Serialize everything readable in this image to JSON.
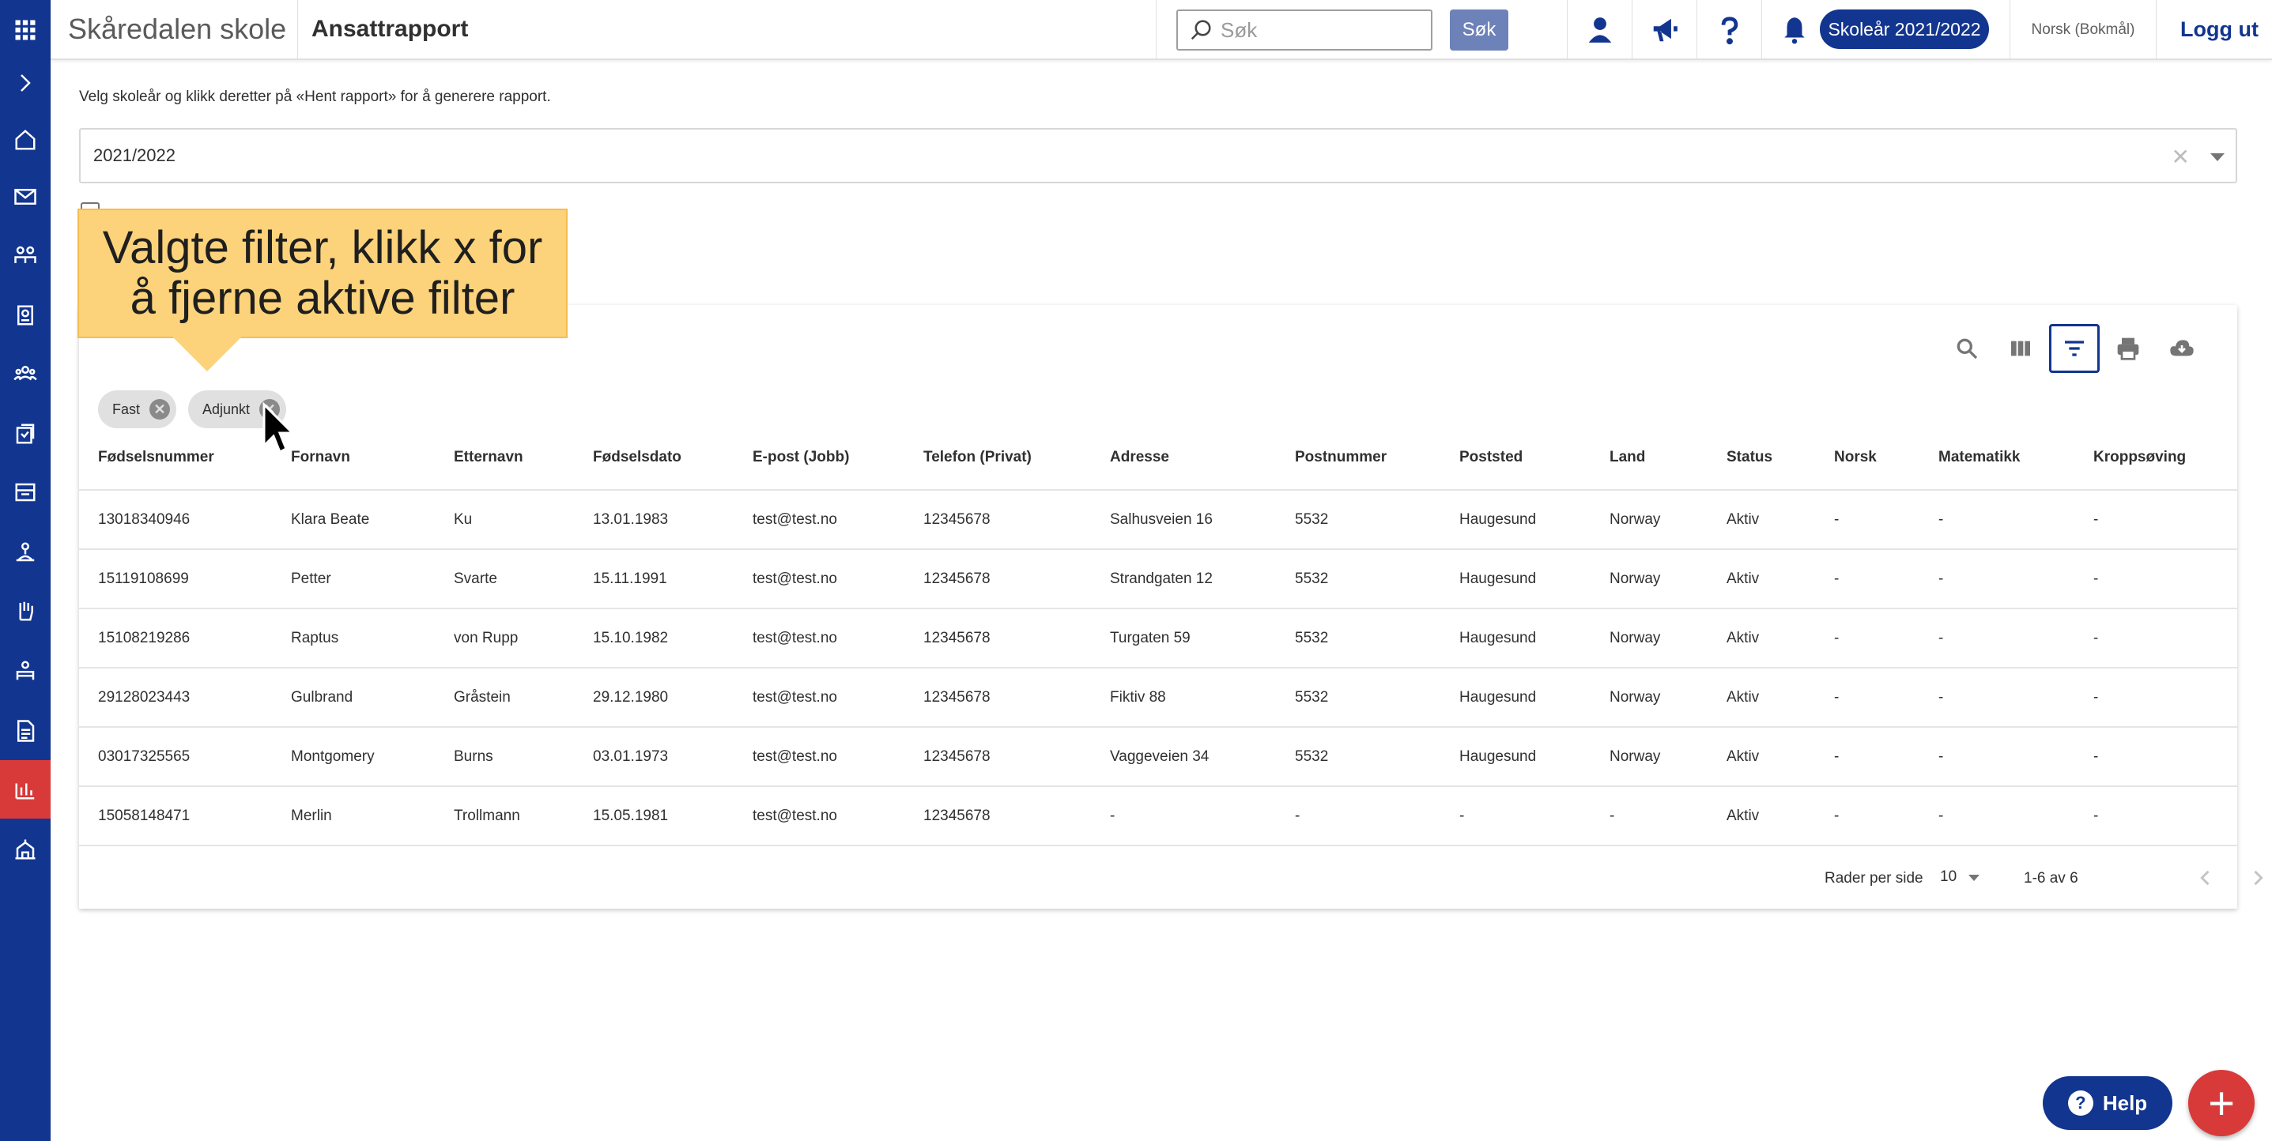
{
  "header": {
    "school_name": "Skåredalen skole",
    "page_title": "Ansattrapport",
    "search_placeholder": "Søk",
    "search_button": "Søk",
    "school_year_button": "Skoleår 2021/2022",
    "language": "Norsk (Bokmål)",
    "logout": "Logg ut"
  },
  "sidebar": {
    "items": [
      {
        "icon": "apps-grid-icon"
      },
      {
        "icon": "chevron-right-icon"
      },
      {
        "icon": "home-icon"
      },
      {
        "icon": "mail-icon"
      },
      {
        "icon": "people-icon"
      },
      {
        "icon": "badge-icon"
      },
      {
        "icon": "group-icon"
      },
      {
        "icon": "assignment-icon"
      },
      {
        "icon": "school-icon"
      },
      {
        "icon": "person-service-icon"
      },
      {
        "icon": "hand-icon"
      },
      {
        "icon": "teacher-icon"
      },
      {
        "icon": "document-icon"
      },
      {
        "icon": "report-chart-icon",
        "active": true
      },
      {
        "icon": "building-icon"
      }
    ]
  },
  "main": {
    "instruction": "Velg skoleår og klikk deretter på «Hent rapport» for å generere rapport.",
    "school_year_value": "2021/2022"
  },
  "callout": {
    "line1": "Valgte filter, klikk x for",
    "line2": "å fjerne aktive filter"
  },
  "filters": [
    "Fast",
    "Adjunkt"
  ],
  "table": {
    "columns": [
      "Fødselsnummer",
      "Fornavn",
      "Etternavn",
      "Fødselsdato",
      "E-post (Jobb)",
      "Telefon (Privat)",
      "Adresse",
      "Postnummer",
      "Poststed",
      "Land",
      "Status",
      "Norsk",
      "Matematikk",
      "Kroppsøving"
    ],
    "rows": [
      [
        "13018340946",
        "Klara Beate",
        "Ku",
        "13.01.1983",
        "test@test.no",
        "12345678",
        "Salhusveien 16",
        "5532",
        "Haugesund",
        "Norway",
        "Aktiv",
        "-",
        "-",
        "-"
      ],
      [
        "15119108699",
        "Petter",
        "Svarte",
        "15.11.1991",
        "test@test.no",
        "12345678",
        "Strandgaten 12",
        "5532",
        "Haugesund",
        "Norway",
        "Aktiv",
        "-",
        "-",
        "-"
      ],
      [
        "15108219286",
        "Raptus",
        "von Rupp",
        "15.10.1982",
        "test@test.no",
        "12345678",
        "Turgaten 59",
        "5532",
        "Haugesund",
        "Norway",
        "Aktiv",
        "-",
        "-",
        "-"
      ],
      [
        "29128023443",
        "Gulbrand",
        "Gråstein",
        "29.12.1980",
        "test@test.no",
        "12345678",
        "Fiktiv 88",
        "5532",
        "Haugesund",
        "Norway",
        "Aktiv",
        "-",
        "-",
        "-"
      ],
      [
        "03017325565",
        "Montgomery",
        "Burns",
        "03.01.1973",
        "test@test.no",
        "12345678",
        "Vaggeveien 34",
        "5532",
        "Haugesund",
        "Norway",
        "Aktiv",
        "-",
        "-",
        "-"
      ],
      [
        "15058148471",
        "Merlin",
        "Trollmann",
        "15.05.1981",
        "test@test.no",
        "12345678",
        "-",
        "-",
        "-",
        "-",
        "Aktiv",
        "-",
        "-",
        "-"
      ]
    ]
  },
  "pagination": {
    "rows_per_page_label": "Rader per side",
    "rows_per_page_value": "10",
    "range": "1-6 av 6"
  },
  "help_button": "Help",
  "colors": {
    "brand": "#12358f",
    "active_nav": "#d83a3a",
    "callout": "#fcd37a"
  }
}
